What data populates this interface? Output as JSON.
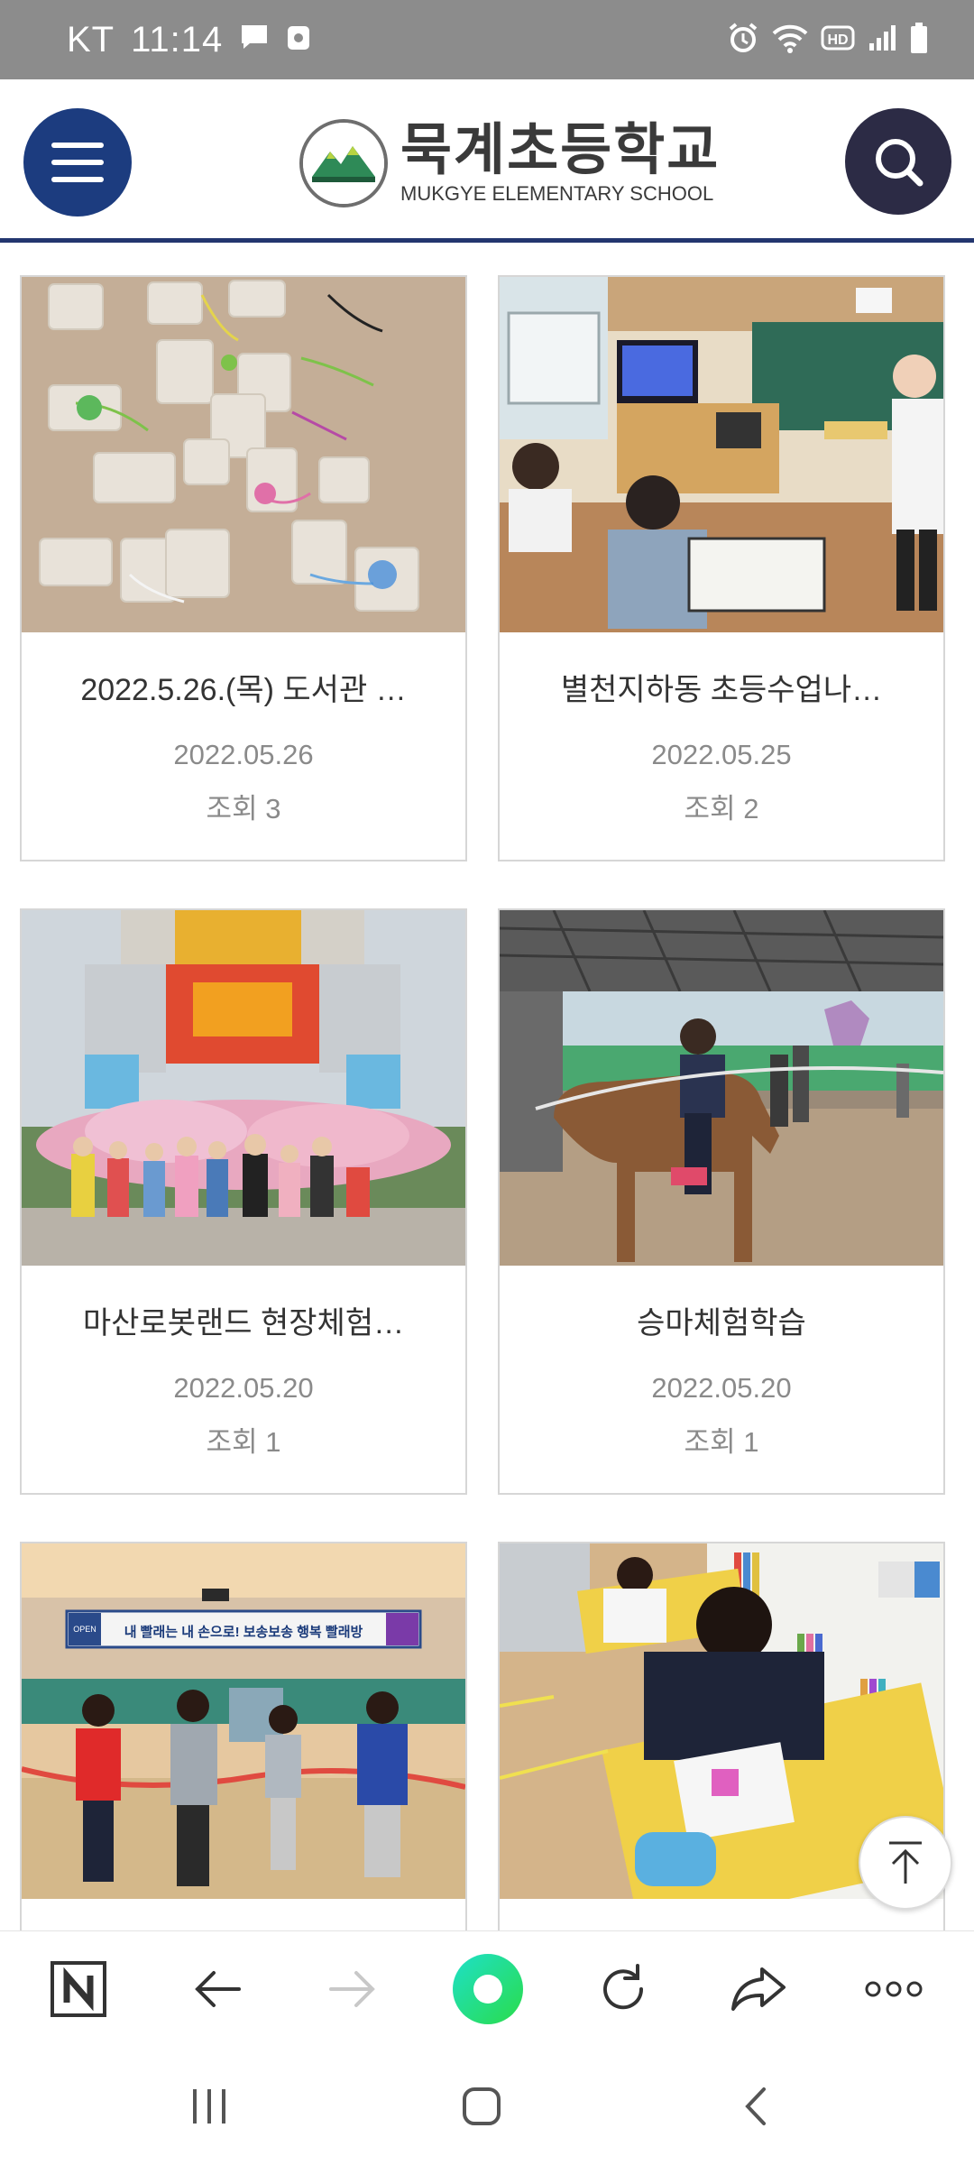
{
  "status_bar": {
    "carrier": "KT",
    "time": "11:14",
    "icons": [
      "message-icon",
      "notification-badge-icon",
      "alarm-icon",
      "wifi-icon",
      "hd-icon",
      "signal-icon",
      "battery-icon"
    ],
    "hd_label": "HD"
  },
  "header": {
    "logo_kr": "묵계초등학교",
    "logo_en": "MUKGYE ELEMENTARY SCHOOL",
    "accent_color": "#23366f"
  },
  "posts": [
    {
      "title": "2022.5.26.(목) 도서관 …",
      "date": "2022.05.26",
      "views": "조회 3"
    },
    {
      "title": "별천지하동 초등수업나…",
      "date": "2022.05.25",
      "views": "조회 2"
    },
    {
      "title": "마산로봇랜드 현장체험…",
      "date": "2022.05.20",
      "views": "조회 1"
    },
    {
      "title": "승마체험학습",
      "date": "2022.05.20",
      "views": "조회 1"
    }
  ],
  "photo5": {
    "banner_text": "내 빨래는 내 손으로! 보송보송 행복 빨래방",
    "badge": "OPEN"
  },
  "toolbar_items": [
    "naver-home-icon",
    "back-icon",
    "forward-icon",
    "green-dot-icon",
    "reload-icon",
    "share-icon",
    "more-icon"
  ]
}
